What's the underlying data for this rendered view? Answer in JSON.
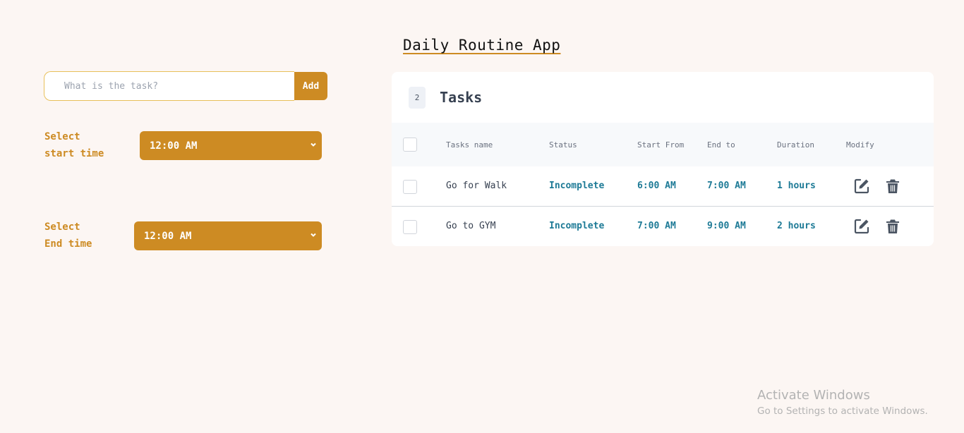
{
  "app": {
    "title": "Daily Routine App"
  },
  "form": {
    "task_placeholder": "What is the task?",
    "add_label": "Add",
    "start_label_line1": "Select",
    "start_label_line2": "start time",
    "start_value": "12:00 AM",
    "end_label_line1": "Select",
    "end_label_line2": "End time",
    "end_value": "12:00 AM"
  },
  "tasks": {
    "count": "2",
    "title": "Tasks",
    "headers": {
      "name": "Tasks name",
      "status": "Status",
      "start": "Start From",
      "end": "End to",
      "duration": "Duration",
      "modify": "Modify"
    },
    "rows": [
      {
        "name": "Go for Walk",
        "status": "Incomplete",
        "start": "6:00 AM",
        "end": "7:00 AM",
        "duration": "1 hours"
      },
      {
        "name": "Go to GYM",
        "status": "Incomplete",
        "start": "7:00 AM",
        "end": "9:00 AM",
        "duration": "2 hours"
      }
    ]
  },
  "watermark": {
    "line1": "Activate Windows",
    "line2": "Go to Settings to activate Windows."
  },
  "colors": {
    "accent": "#cd8b23",
    "value_text": "#1d7a96",
    "background": "#fcf6f3"
  },
  "icons": [
    "chevron-down-icon",
    "edit-icon",
    "trash-icon"
  ]
}
